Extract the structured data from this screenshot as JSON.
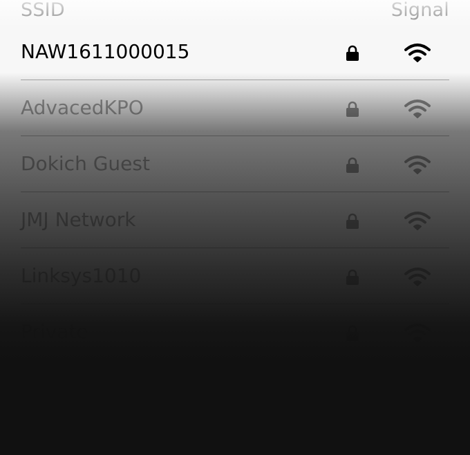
{
  "header": {
    "ssid_label": "SSID",
    "signal_label": "Signal"
  },
  "networks": [
    {
      "ssid": "NAW1611000015",
      "locked": true,
      "signal_icon": "wifi-icon"
    },
    {
      "ssid": "AdvacedKPO",
      "locked": true,
      "signal_icon": "wifi-icon"
    },
    {
      "ssid": "Dokich Guest",
      "locked": true,
      "signal_icon": "wifi-icon"
    },
    {
      "ssid": "JMJ Network",
      "locked": true,
      "signal_icon": "wifi-icon"
    },
    {
      "ssid": "Linksys1010",
      "locked": true,
      "signal_icon": "wifi-icon"
    },
    {
      "ssid": "Private",
      "locked": true,
      "signal_icon": "wifi-icon"
    }
  ],
  "colors": {
    "text": "#000000",
    "divider": "#aaaaaa",
    "bottom_overlay": "#111111"
  }
}
